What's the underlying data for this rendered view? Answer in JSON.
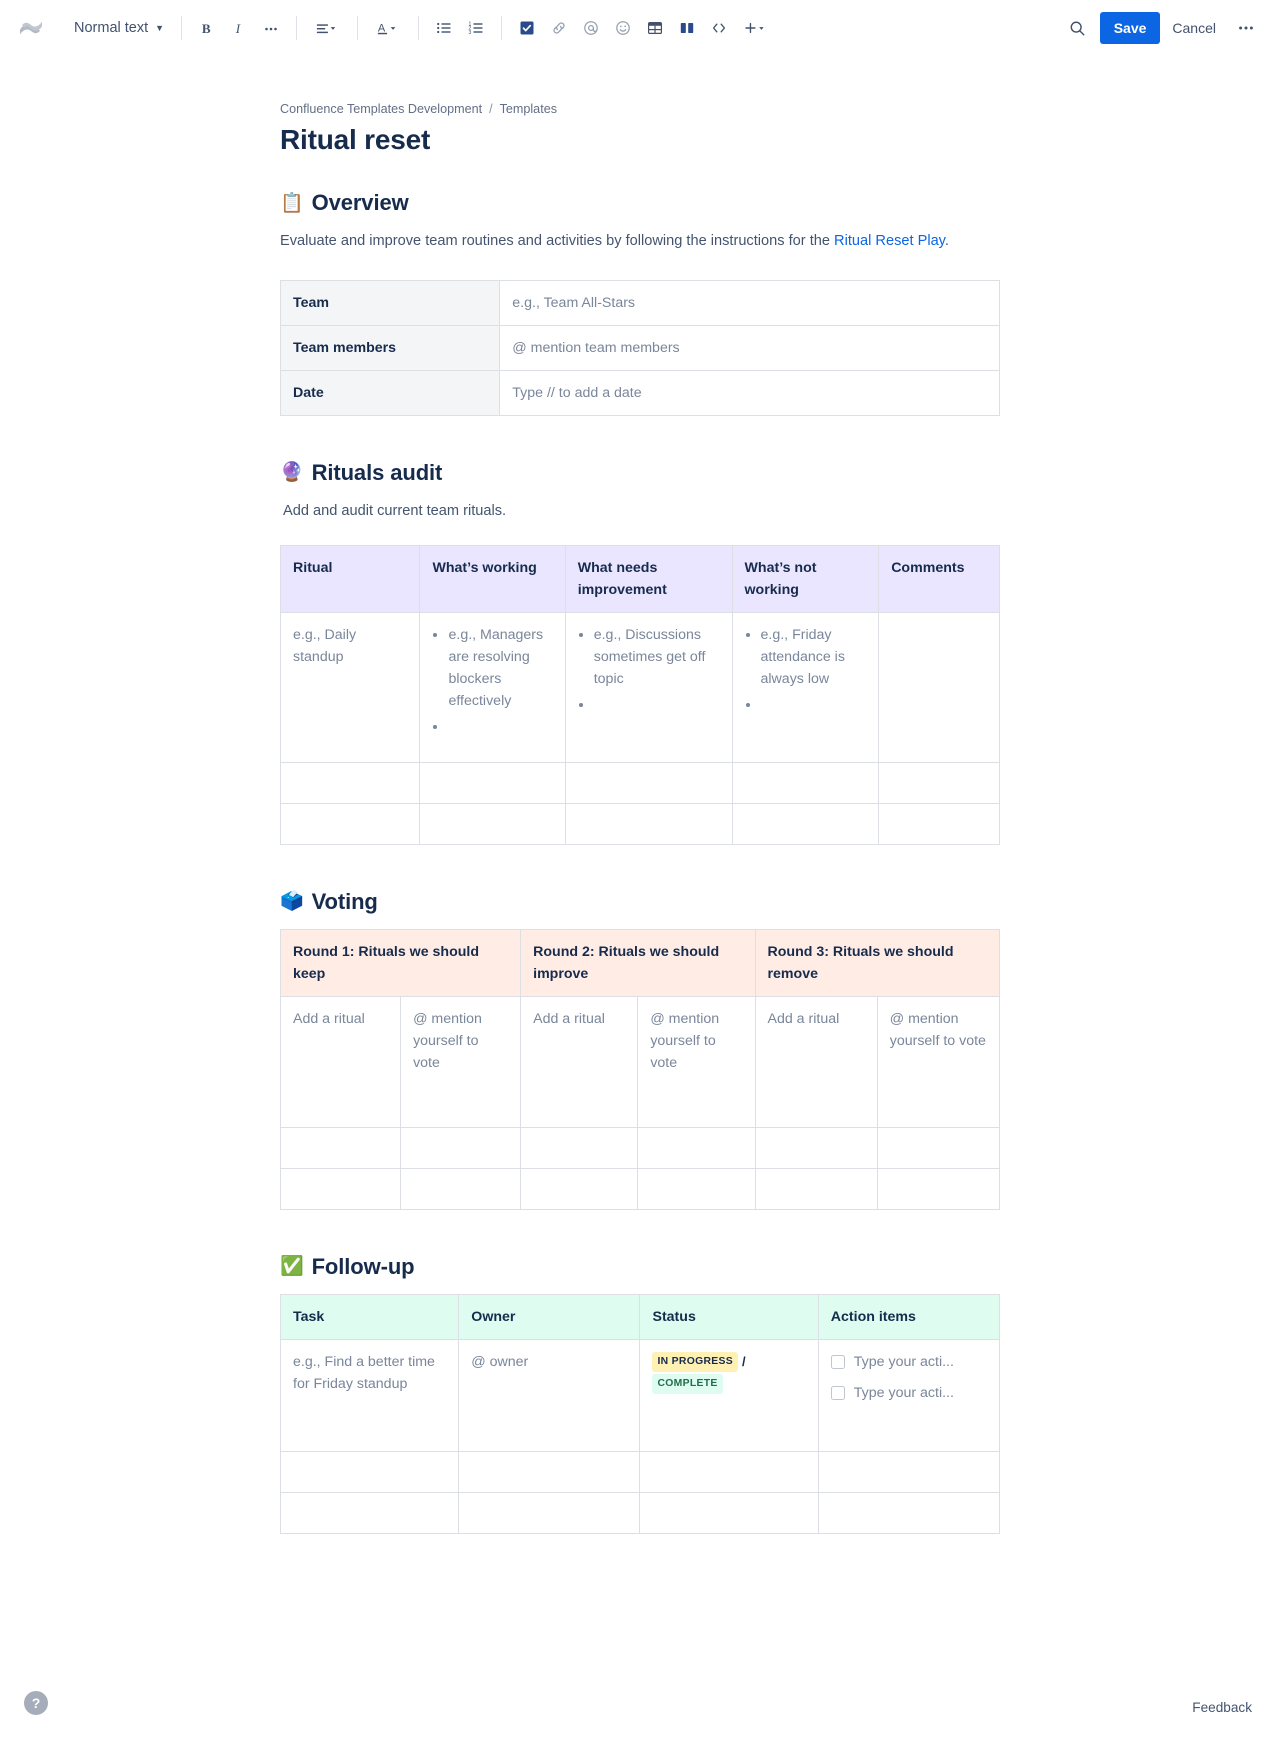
{
  "toolbar": {
    "logo_name": "confluence-logo",
    "text_style": "Normal text",
    "bold": "B",
    "italic": "I",
    "more_formatting": "•••",
    "search_icon": "search-icon",
    "save_label": "Save",
    "cancel_label": "Cancel",
    "overflow_label": "•••"
  },
  "breadcrumb": {
    "space": "Confluence Templates Development",
    "separator": "/",
    "parent": "Templates"
  },
  "page": {
    "title": "Ritual reset"
  },
  "overview": {
    "emoji": "📋",
    "heading": "Overview",
    "paragraph_before_link": "Evaluate and improve team routines and activities by following the instructions for the ",
    "link_text": "Ritual Reset Play",
    "paragraph_after_link": ".",
    "rows": [
      {
        "label": "Team",
        "value": "e.g., Team All-Stars"
      },
      {
        "label": "Team members",
        "value": "@ mention team members"
      },
      {
        "label": "Date",
        "value": "Type // to add a date"
      }
    ]
  },
  "rituals_audit": {
    "emoji": "🔮",
    "heading": "Rituals audit",
    "description": "Add and audit current team rituals.",
    "headers": [
      "Ritual",
      "What’s working",
      "What needs improvement",
      "What’s not working",
      "Comments"
    ],
    "example_row": {
      "ritual": "e.g., Daily standup",
      "whats_working": [
        "e.g., Managers are resolving blockers effectively",
        ""
      ],
      "needs_improvement": [
        "e.g., Discussions sometimes get off topic",
        ""
      ],
      "not_working": [
        "e.g., Friday attendance is always low",
        ""
      ],
      "comments": ""
    },
    "blank_rows": 2
  },
  "voting": {
    "emoji": "🗳️",
    "heading": "Voting",
    "headers": [
      "Round 1: Rituals we should keep",
      "Round 2: Rituals we should improve",
      "Round 3: Rituals we should remove"
    ],
    "entry_row": {
      "ritual_placeholder": "Add a ritual",
      "vote_placeholder": "@ mention yourself to vote"
    },
    "blank_rows": 2
  },
  "follow_up": {
    "emoji": "✅",
    "heading": "Follow-up",
    "headers": [
      "Task",
      "Owner",
      "Status",
      "Action items"
    ],
    "entry_row": {
      "task": "e.g., Find a better time for Friday standup",
      "owner": "@ owner",
      "status_in_progress": "IN PROGRESS",
      "status_separator": "/",
      "status_complete": "COMPLETE",
      "action_item_1": "Type your acti...",
      "action_item_2": "Type your acti..."
    },
    "blank_rows": 2
  },
  "footer": {
    "help_label": "?",
    "feedback_label": "Feedback"
  },
  "colors": {
    "accent_blue": "#0C66E4",
    "audit_header": "#EAE6FF",
    "voting_header": "#FFEDE5",
    "followup_header": "#DFFCF0",
    "lozenge_yellow": "#FFF0B3",
    "lozenge_green": "#DFFCF0"
  }
}
